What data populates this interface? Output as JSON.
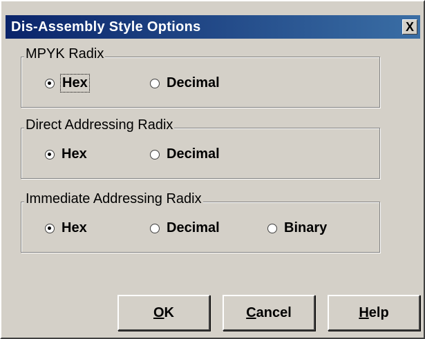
{
  "title": "Dis-Assembly Style Options",
  "close_label": "X",
  "groups": [
    {
      "label": "MPYK Radix",
      "options": [
        {
          "label": "Hex",
          "checked": true,
          "focused": true
        },
        {
          "label": "Decimal",
          "checked": false
        }
      ]
    },
    {
      "label": "Direct Addressing Radix",
      "options": [
        {
          "label": "Hex",
          "checked": true
        },
        {
          "label": "Decimal",
          "checked": false
        }
      ]
    },
    {
      "label": "Immediate Addressing Radix",
      "options": [
        {
          "label": "Hex",
          "checked": true
        },
        {
          "label": "Decimal",
          "checked": false
        },
        {
          "label": "Binary",
          "checked": false
        }
      ]
    }
  ],
  "buttons": {
    "ok": {
      "mnemonic": "O",
      "rest": "K"
    },
    "cancel": {
      "mnemonic": "C",
      "rest": "ancel"
    },
    "help": {
      "mnemonic": "H",
      "rest": "elp"
    }
  }
}
